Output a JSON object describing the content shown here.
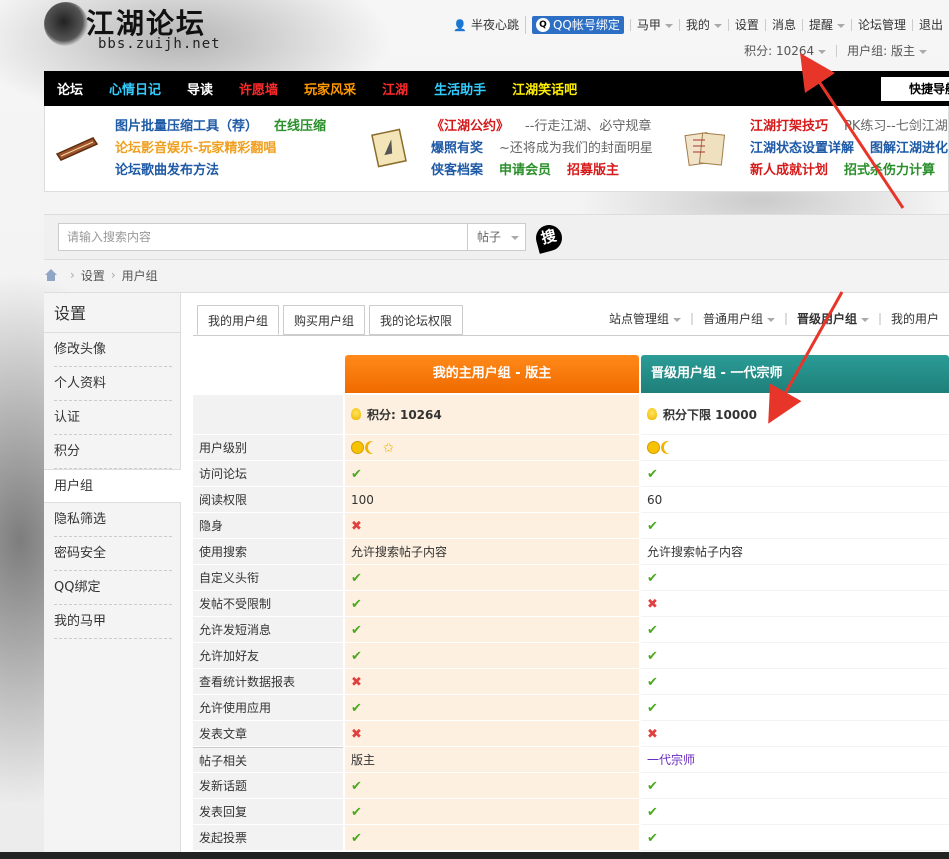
{
  "header": {
    "logo_text": "江湖论坛",
    "logo_url": "bbs.zuijh.net"
  },
  "userbar": {
    "username": "半夜心跳",
    "qq_bind": "QQ帐号绑定",
    "items": [
      "马甲",
      "我的",
      "设置",
      "消息",
      "提醒",
      "论坛管理",
      "退出"
    ]
  },
  "scorebar": {
    "score": "积分: 10264",
    "group": "用户组: 版主"
  },
  "nav": {
    "items": [
      {
        "label": "论坛",
        "color": "#ffffff"
      },
      {
        "label": "心情日记",
        "color": "#33ccff"
      },
      {
        "label": "导读",
        "color": "#ffffff"
      },
      {
        "label": "许愿墙",
        "color": "#ff2a2a"
      },
      {
        "label": "玩家风采",
        "color": "#ff9900"
      },
      {
        "label": "江湖",
        "color": "#ff2a2a"
      },
      {
        "label": "生活助手",
        "color": "#33ccff"
      },
      {
        "label": "江湖笑话吧",
        "color": "#ffee00"
      }
    ],
    "quick": "快捷导航"
  },
  "promo": {
    "col1": {
      "row1": [
        {
          "t": "图片批量压缩工具（荐）",
          "c": "blue"
        },
        {
          "t": "在线压缩",
          "c": "green"
        }
      ],
      "row2": [
        {
          "t": "论坛影音娱乐-玩家精彩翻唱",
          "c": "orange"
        }
      ],
      "row3": [
        {
          "t": "论坛歌曲发布方法",
          "c": "blue"
        }
      ]
    },
    "col2": {
      "row1": [
        {
          "t": "《江湖公约》",
          "c": "red"
        },
        {
          "t": "--行走江湖、必守规章",
          "c": "gray"
        }
      ],
      "row2": [
        {
          "t": "爆照有奖",
          "c": "blue"
        },
        {
          "t": "~还将成为我们的封面明星",
          "c": "gray"
        }
      ],
      "row3": [
        {
          "t": "侠客档案",
          "c": "blue"
        },
        {
          "t": "申请会员",
          "c": "green"
        },
        {
          "t": "招募版主",
          "c": "red"
        }
      ]
    },
    "col3": {
      "row1": [
        {
          "t": "江湖打架技巧",
          "c": "red"
        },
        {
          "t": "PK练习--七剑江湖",
          "c": "gray"
        }
      ],
      "row2": [
        {
          "t": "江湖状态设置详解",
          "c": "blue"
        },
        {
          "t": "图解江湖进化",
          "c": "blue"
        }
      ],
      "row3": [
        {
          "t": "新人成就计划",
          "c": "red"
        },
        {
          "t": "招式杀伤力计算",
          "c": "green"
        }
      ]
    }
  },
  "search": {
    "placeholder": "请输入搜索内容",
    "type": "帖子",
    "button": "搜"
  },
  "breadcrumb": [
    "设置",
    "用户组"
  ],
  "sidebar": {
    "title": "设置",
    "items": [
      "修改头像",
      "个人资料",
      "认证",
      "积分",
      "用户组",
      "隐私筛选",
      "密码安全",
      "QQ绑定",
      "我的马甲"
    ],
    "active": "用户组"
  },
  "tabs": [
    "我的用户组",
    "购买用户组",
    "我的论坛权限"
  ],
  "subtabs": [
    "站点管理组",
    "普通用户组",
    "晋级用户组",
    "我的用户"
  ],
  "table": {
    "col1_header": "我的主用户组 - 版主",
    "col2_header": "晋级用户组 - 一代宗师",
    "col1_score": "积分: 10264",
    "col2_score": "积分下限 10000",
    "rows": [
      {
        "label": "用户级别",
        "c1": "lv3",
        "c2": "lv2"
      },
      {
        "label": "访问论坛",
        "c1": "ok",
        "c2": "ok"
      },
      {
        "label": "阅读权限",
        "c1": "100",
        "c2": "60"
      },
      {
        "label": "隐身",
        "c1": "no",
        "c2": "ok"
      },
      {
        "label": "使用搜索",
        "c1": "允许搜索帖子内容",
        "c2": "允许搜索帖子内容"
      },
      {
        "label": "自定义头衔",
        "c1": "ok",
        "c2": "ok"
      },
      {
        "label": "发帖不受限制",
        "c1": "ok",
        "c2": "no"
      },
      {
        "label": "允许发短消息",
        "c1": "ok",
        "c2": "ok"
      },
      {
        "label": "允许加好友",
        "c1": "ok",
        "c2": "ok"
      },
      {
        "label": "查看统计数据报表",
        "c1": "no",
        "c2": "ok"
      },
      {
        "label": "允许使用应用",
        "c1": "ok",
        "c2": "ok"
      },
      {
        "label": "发表文章",
        "c1": "no",
        "c2": "no"
      },
      {
        "label": "帖子相关",
        "c1": "版主",
        "c2": "一代宗师",
        "section": true
      },
      {
        "label": "发新话题",
        "c1": "ok",
        "c2": "ok"
      },
      {
        "label": "发表回复",
        "c1": "ok",
        "c2": "ok"
      },
      {
        "label": "发起投票",
        "c1": "ok",
        "c2": "ok"
      }
    ]
  }
}
